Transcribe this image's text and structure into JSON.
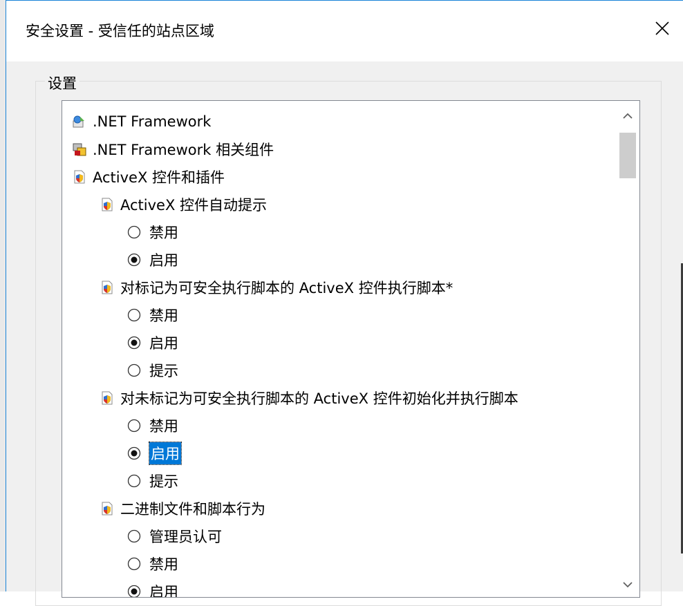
{
  "window": {
    "title": "安全设置 - 受信任的站点区域",
    "close_glyph": "✕"
  },
  "group": {
    "label": "设置"
  },
  "settings": [
    {
      "kind": "category",
      "label": ".NET Framework",
      "icon": "net-framework-icon"
    },
    {
      "kind": "category",
      "label": ".NET Framework 相关组件",
      "icon": "net-components-icon"
    },
    {
      "kind": "category",
      "label": "ActiveX 控件和插件",
      "icon": "shield-page-icon"
    },
    {
      "kind": "setting",
      "label": "ActiveX 控件自动提示",
      "icon": "shield-page-icon"
    },
    {
      "kind": "option",
      "label": "禁用",
      "checked": false
    },
    {
      "kind": "option",
      "label": "启用",
      "checked": true
    },
    {
      "kind": "setting",
      "label": "对标记为可安全执行脚本的 ActiveX 控件执行脚本*",
      "icon": "shield-page-icon"
    },
    {
      "kind": "option",
      "label": "禁用",
      "checked": false
    },
    {
      "kind": "option",
      "label": "启用",
      "checked": true
    },
    {
      "kind": "option",
      "label": "提示",
      "checked": false
    },
    {
      "kind": "setting",
      "label": "对未标记为可安全执行脚本的 ActiveX 控件初始化并执行脚本",
      "icon": "shield-page-icon"
    },
    {
      "kind": "option",
      "label": "禁用",
      "checked": false
    },
    {
      "kind": "option",
      "label": "启用",
      "checked": true,
      "selected": true
    },
    {
      "kind": "option",
      "label": "提示",
      "checked": false
    },
    {
      "kind": "setting",
      "label": "二进制文件和脚本行为",
      "icon": "shield-page-icon"
    },
    {
      "kind": "option",
      "label": "管理员认可",
      "checked": false
    },
    {
      "kind": "option",
      "label": "禁用",
      "checked": false
    },
    {
      "kind": "option",
      "label": "启用",
      "checked": true
    }
  ],
  "colors": {
    "selection": "#0078d7",
    "window_border": "#1883d7"
  }
}
